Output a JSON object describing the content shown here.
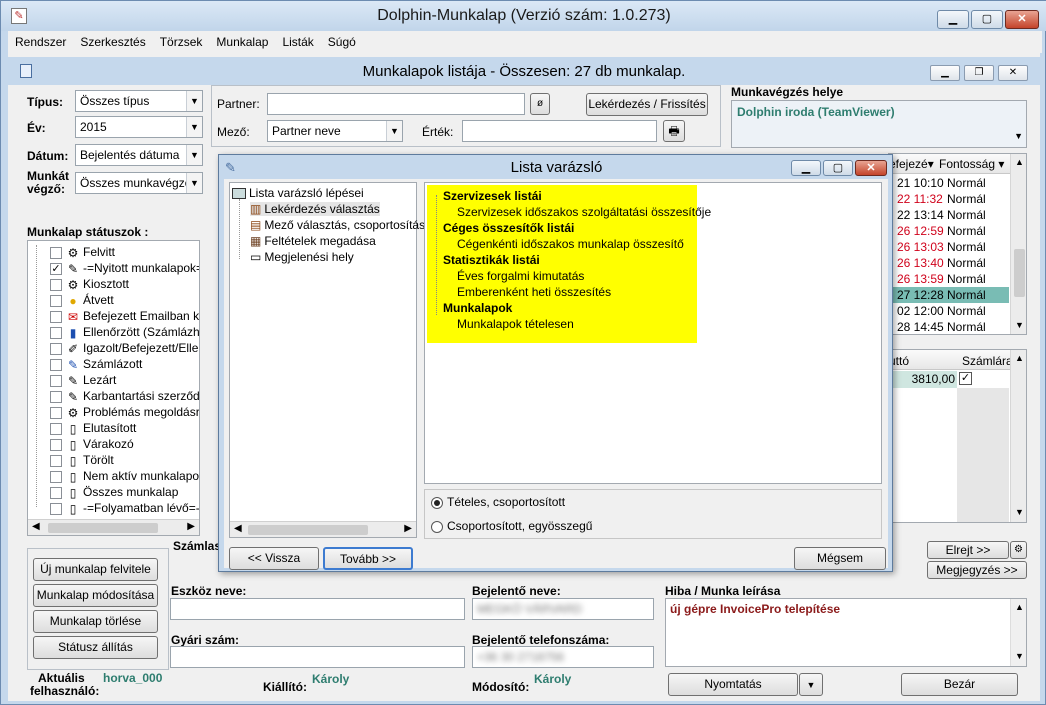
{
  "app": {
    "title": "Dolphin-Munkalap  (Verzió szám: 1.0.273)",
    "minimize": "▁",
    "maximize": "▢",
    "close": "✕"
  },
  "menu": [
    "Rendszer",
    "Szerkesztés",
    "Törzsek",
    "Munkalap",
    "Listák",
    "Súgó"
  ],
  "subwindow": {
    "title": "Munkalapok listája  -  Összesen: 27 db munkalap."
  },
  "filters": {
    "type_label": "Típus:",
    "type_value": "Összes típus",
    "year_label": "Év:",
    "year_value": "2015",
    "date_label": "Dátum:",
    "date_value": "Bejelentés dátuma",
    "worker_label_1": "Munkát",
    "worker_label_2": "végző:",
    "worker_value": "Összes munkavégző",
    "partner_label": "Partner:",
    "partner_value": "",
    "field_label": "Mező:",
    "field_value": "Partner neve",
    "value_label": "Érték:",
    "value_value": "",
    "query_button": "Lekérdezés / Frissítés"
  },
  "worksite": {
    "label": "Munkavégzés helye",
    "value": "Dolphin iroda (TeamViewer)"
  },
  "statuses": {
    "label": "Munkalap státuszok :",
    "items": [
      {
        "label": "Felvitt",
        "checked": false,
        "icon": "⚙"
      },
      {
        "label": "-=Nyitott munkalapok=-",
        "checked": true,
        "icon": "✎"
      },
      {
        "label": "Kiosztott",
        "checked": false,
        "icon": "⚙"
      },
      {
        "label": "Átvett",
        "checked": false,
        "icon": "●"
      },
      {
        "label": "Befejezett Emailban kikü",
        "checked": false,
        "icon": "✉"
      },
      {
        "label": "Ellenőrzött (Számlázható",
        "checked": false,
        "icon": "▮"
      },
      {
        "label": "Igazolt/Befejezett/Ellenő",
        "checked": false,
        "icon": "✐"
      },
      {
        "label": "Számlázott",
        "checked": false,
        "icon": "✎"
      },
      {
        "label": "Lezárt",
        "checked": false,
        "icon": "✎"
      },
      {
        "label": "Karbantartási szerződés",
        "checked": false,
        "icon": "✎"
      },
      {
        "label": "Problémás megoldásra v",
        "checked": false,
        "icon": "⚙"
      },
      {
        "label": "Elutasított",
        "checked": false,
        "icon": "▯"
      },
      {
        "label": "Várakozó",
        "checked": false,
        "icon": "▯"
      },
      {
        "label": "Törölt",
        "checked": false,
        "icon": "▯"
      },
      {
        "label": "Nem aktív munkalapok",
        "checked": false,
        "icon": "▯"
      },
      {
        "label": "Összes munkalap",
        "checked": false,
        "icon": "▯"
      },
      {
        "label": "-=Folyamatban lévő=-",
        "checked": false,
        "icon": "▯"
      }
    ]
  },
  "grid": {
    "col_finished": "efejezé▾",
    "col_priority": "Fontosság ▾",
    "rows": [
      {
        "date": "21 10:10",
        "priority": "Normál",
        "red": false
      },
      {
        "date": "22 11:32",
        "priority": "Normál",
        "red": true
      },
      {
        "date": "22 13:14",
        "priority": "Normál",
        "red": false
      },
      {
        "date": "26 12:59",
        "priority": "Normál",
        "red": true
      },
      {
        "date": "26 13:03",
        "priority": "Normál",
        "red": true
      },
      {
        "date": "26 13:40",
        "priority": "Normál",
        "red": true
      },
      {
        "date": "26 13:59",
        "priority": "Normál",
        "red": true
      },
      {
        "date": "27 12:28",
        "priority": "Normál",
        "red": false
      },
      {
        "date": "02 12:00",
        "priority": "Normál",
        "red": false
      },
      {
        "date": "28 14:45",
        "priority": "Normál",
        "red": false
      }
    ]
  },
  "lower_grid": {
    "col_gross": "uttó",
    "col_invoice": "Számlára",
    "amount": "3810,00"
  },
  "buttons": {
    "new": "Új munkalap felvitele",
    "modify": "Munkalap módosítása",
    "delete": "Munkalap törlése",
    "status": "Státusz állítás",
    "hide": "Elrejt >>",
    "note": "Megjegyzés >>",
    "print": "Nyomtatás",
    "close": "Bezár"
  },
  "details": {
    "invoicing_partial": "Számlas",
    "device_label": "Eszköz neve:",
    "device_value": "",
    "serial_label": "Gyári szám:",
    "serial_value": "",
    "reporter_label": "Bejelentő neve:",
    "reporter_value": "MEGKÖ VÁRVARD",
    "reporter_phone_label": "Bejelentő telefonszáma:",
    "reporter_phone_value": "+36 30 2718756",
    "issue_label": "Hiba / Munka leírása",
    "issue_value": "új gépre InvoicePro telepítése",
    "current_user_label_1": "Aktuális",
    "current_user_label_2": "felhasználó:",
    "current_user_value": "horva_000",
    "issuer_label": "Kiállító:",
    "issuer_value": "Károly",
    "modifier_label": "Módosító:",
    "modifier_value": "Károly"
  },
  "wizard": {
    "title": "Lista varázsló",
    "steps_root": "Lista varázsló lépései",
    "steps": [
      "Lekérdezés választás",
      "Mező választás, csoportosítás,",
      "Feltételek megadása",
      "Megjelenési hely"
    ],
    "groups": [
      {
        "name": "Szervizesek listái",
        "items": [
          "Szervizesek időszakos szolgáltatási összesítője"
        ]
      },
      {
        "name": "Céges összesítők listái",
        "items": [
          "Cégenkénti időszakos munkalap összesítő"
        ]
      },
      {
        "name": "Statisztikák listái",
        "items": [
          "Éves forgalmi kimutatás",
          "Emberenként heti összesítés"
        ]
      },
      {
        "name": "Munkalapok",
        "items": [
          "Munkalapok tételesen"
        ]
      }
    ],
    "radio_itemized": "Tételes, csoportosított",
    "radio_grouped": "Csoportosított, egyösszegű",
    "back": "<< Vissza",
    "next": "Tovább >>",
    "cancel": "Mégsem"
  },
  "colors": {
    "accent_green": "#2e7d6f",
    "highlight_yellow": "#ffff00",
    "red_text": "#d0021b",
    "issue_text": "#8b1a1a"
  }
}
